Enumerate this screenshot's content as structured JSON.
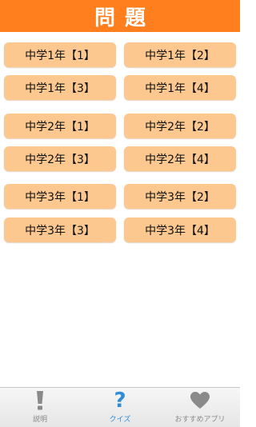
{
  "header": {
    "title": "問題"
  },
  "quiz_buttons": [
    "中学1年【1】",
    "中学1年【2】",
    "中学1年【3】",
    "中学1年【4】",
    "中学2年【1】",
    "中学2年【2】",
    "中学2年【3】",
    "中学2年【4】",
    "中学3年【1】",
    "中学3年【2】",
    "中学3年【3】",
    "中学3年【4】"
  ],
  "tabbar": {
    "tabs": [
      {
        "label": "説明",
        "icon": "exclamation-icon"
      },
      {
        "label": "クイズ",
        "icon": "question-mark-icon",
        "active": true
      },
      {
        "label": "おすすめアプリ",
        "icon": "heart-icon"
      }
    ]
  },
  "colors": {
    "header_bg": "#ff7f1e",
    "button_bg": "#fdc790",
    "active_tab": "#2f8ed6",
    "inactive_tab": "#8a8a8a"
  }
}
